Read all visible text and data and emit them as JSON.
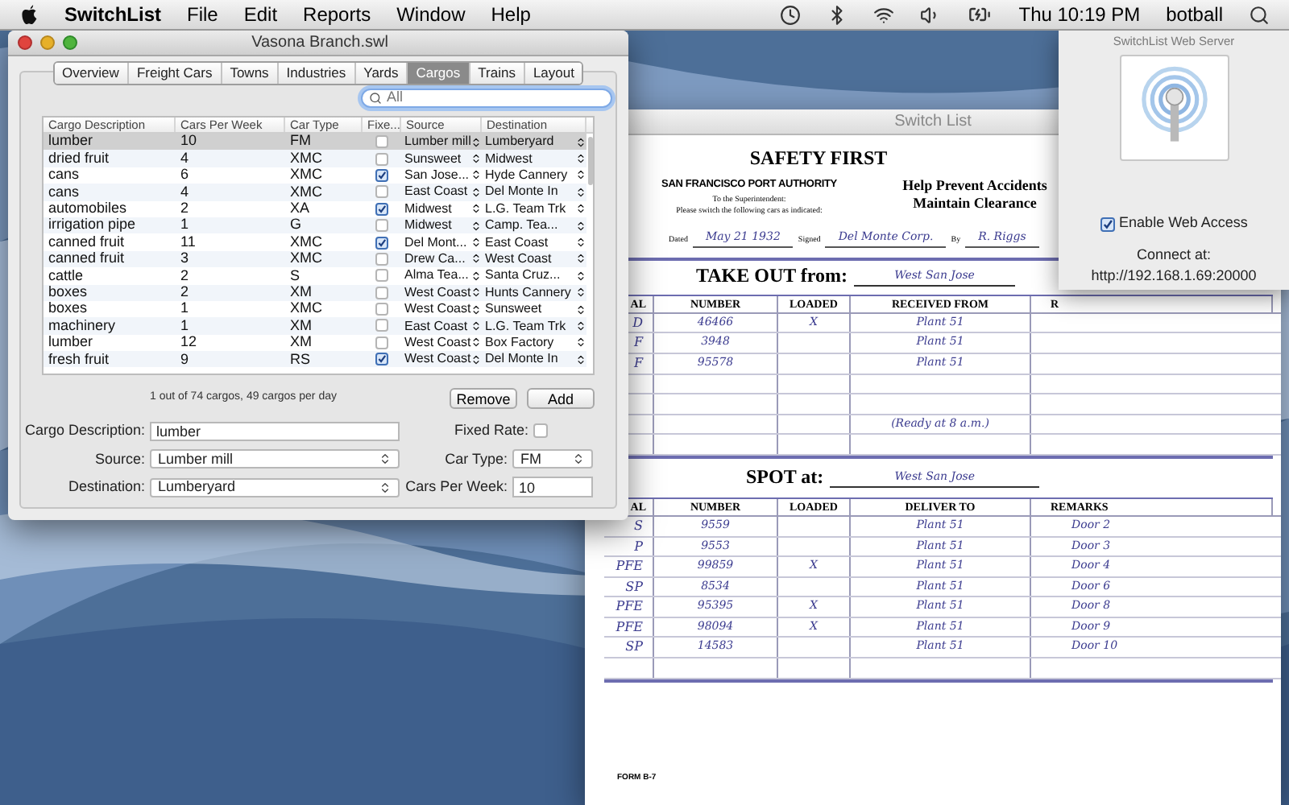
{
  "menu_bar": {
    "app": "SwitchList",
    "menus": [
      "File",
      "Edit",
      "Reports",
      "Window",
      "Help"
    ],
    "clock": "Thu 10:19 PM",
    "user": "botball"
  },
  "main_window": {
    "title": "Vasona Branch.swl",
    "tabs": [
      {
        "label": "Overview",
        "selected": false
      },
      {
        "label": "Freight Cars",
        "selected": false
      },
      {
        "label": "Towns",
        "selected": false
      },
      {
        "label": "Industries",
        "selected": false
      },
      {
        "label": "Yards",
        "selected": false
      },
      {
        "label": "Cargos",
        "selected": true
      },
      {
        "label": "Trains",
        "selected": false
      },
      {
        "label": "Layout",
        "selected": false
      }
    ],
    "search": {
      "placeholder": "All"
    },
    "columns": [
      "Cargo Description",
      "Cars Per Week",
      "Car Type",
      "Fixe...",
      "Source",
      "Destination"
    ],
    "rows": [
      {
        "description": "lumber",
        "cars_per_week": "10",
        "car_type": "FM",
        "fixed": false,
        "source": "Lumber mill",
        "destination": "Lumberyard",
        "selected": true
      },
      {
        "description": "dried fruit",
        "cars_per_week": "4",
        "car_type": "XMC",
        "fixed": false,
        "source": "Sunsweet",
        "destination": "Midwest",
        "selected": false
      },
      {
        "description": "cans",
        "cars_per_week": "6",
        "car_type": "XMC",
        "fixed": true,
        "source": "San Jose...",
        "destination": "Hyde Cannery",
        "selected": false
      },
      {
        "description": "cans",
        "cars_per_week": "4",
        "car_type": "XMC",
        "fixed": false,
        "source": "East Coast",
        "destination": "Del Monte In",
        "selected": false
      },
      {
        "description": "automobiles",
        "cars_per_week": "2",
        "car_type": "XA",
        "fixed": true,
        "source": "Midwest",
        "destination": "L.G. Team Trk",
        "selected": false
      },
      {
        "description": "irrigation pipe",
        "cars_per_week": "1",
        "car_type": "G",
        "fixed": false,
        "source": "Midwest",
        "destination": "Camp. Tea...",
        "selected": false
      },
      {
        "description": "canned fruit",
        "cars_per_week": "11",
        "car_type": "XMC",
        "fixed": true,
        "source": "Del Mont...",
        "destination": "East Coast",
        "selected": false
      },
      {
        "description": "canned fruit",
        "cars_per_week": "3",
        "car_type": "XMC",
        "fixed": false,
        "source": "Drew Ca...",
        "destination": "West Coast",
        "selected": false
      },
      {
        "description": "cattle",
        "cars_per_week": "2",
        "car_type": "S",
        "fixed": false,
        "source": "Alma Tea...",
        "destination": "Santa Cruz...",
        "selected": false
      },
      {
        "description": "boxes",
        "cars_per_week": "2",
        "car_type": "XM",
        "fixed": false,
        "source": "West Coast",
        "destination": "Hunts Cannery",
        "selected": false
      },
      {
        "description": "boxes",
        "cars_per_week": "1",
        "car_type": "XMC",
        "fixed": false,
        "source": "West Coast",
        "destination": "Sunsweet",
        "selected": false
      },
      {
        "description": "machinery",
        "cars_per_week": "1",
        "car_type": "XM",
        "fixed": false,
        "source": "East Coast",
        "destination": "L.G. Team Trk",
        "selected": false
      },
      {
        "description": "lumber",
        "cars_per_week": "12",
        "car_type": "XM",
        "fixed": false,
        "source": "West Coast",
        "destination": "Box Factory",
        "selected": false
      },
      {
        "description": "fresh fruit",
        "cars_per_week": "9",
        "car_type": "RS",
        "fixed": true,
        "source": "West Coast",
        "destination": "Del Monte In",
        "selected": false
      }
    ],
    "summary": "1 out of 74 cargos, 49 cargos per day",
    "buttons": [
      "Remove",
      "Add"
    ],
    "form": {
      "description": {
        "label": "Cargo Description:",
        "value": "lumber"
      },
      "fixed_rate": {
        "label": "Fixed Rate:",
        "checked": false
      },
      "source": {
        "label": "Source:",
        "value": "Lumber mill"
      },
      "car_type": {
        "label": "Car Type:",
        "value": "FM"
      },
      "destination": {
        "label": "Destination:",
        "value": "Lumberyard"
      },
      "cars_per_week": {
        "label": "Cars Per Week:",
        "value": "10"
      }
    }
  },
  "switch_list": {
    "title": "Switch List",
    "heading": "SAFETY FIRST",
    "authority": "SAN FRANCISCO PORT AUTHORITY",
    "to_line": "To the Superintendent:",
    "instruction": "Please switch the following cars as indicated:",
    "slogan": [
      "Help Prevent Accidents",
      "Maintain Clearance"
    ],
    "signature": [
      {
        "label": "Dated",
        "value": "May 21 1932"
      },
      {
        "label": "Signed",
        "value": "Del Monte Corp."
      },
      {
        "label": "By",
        "value": "R. Riggs"
      }
    ],
    "take_out": {
      "label": "TAKE OUT from:",
      "place": "West San Jose",
      "columns": [
        "AL",
        "NUMBER",
        "LOADED",
        "RECEIVED FROM",
        "R"
      ],
      "rows": [
        {
          "initial": "D",
          "number": "46466",
          "loaded": "X",
          "place": "Plant 51"
        },
        {
          "initial": "F",
          "number": "3948",
          "loaded": "",
          "place": "Plant 51"
        },
        {
          "initial": "F",
          "number": "95578",
          "loaded": "",
          "place": "Plant 51"
        }
      ],
      "note": "(Ready at 8 a.m.)"
    },
    "spot": {
      "label": "SPOT at:",
      "place": "West San Jose",
      "columns": [
        "AL",
        "NUMBER",
        "LOADED",
        "DELIVER TO",
        "REMARKS"
      ],
      "rows": [
        {
          "initial": "S",
          "number": "9559",
          "loaded": "",
          "place": "Plant 51",
          "remarks": "Door 2"
        },
        {
          "initial": "P",
          "number": "9553",
          "loaded": "",
          "place": "Plant 51",
          "remarks": "Door 3"
        },
        {
          "initial": "PFE",
          "number": "99859",
          "loaded": "X",
          "place": "Plant 51",
          "remarks": "Door 4"
        },
        {
          "initial": "SP",
          "number": "8534",
          "loaded": "",
          "place": "Plant 51",
          "remarks": "Door 6"
        },
        {
          "initial": "PFE",
          "number": "95395",
          "loaded": "X",
          "place": "Plant 51",
          "remarks": "Door 8"
        },
        {
          "initial": "PFE",
          "number": "98094",
          "loaded": "X",
          "place": "Plant 51",
          "remarks": "Door 9"
        },
        {
          "initial": "SP",
          "number": "14583",
          "loaded": "",
          "place": "Plant 51",
          "remarks": "Door 10"
        }
      ]
    },
    "form_code": "FORM B-7"
  },
  "web_server": {
    "title": "SwitchList Web Server",
    "enable_label": "Enable Web Access",
    "enabled": true,
    "connect_label": "Connect at:",
    "url": "http://192.168.1.69:20000"
  }
}
